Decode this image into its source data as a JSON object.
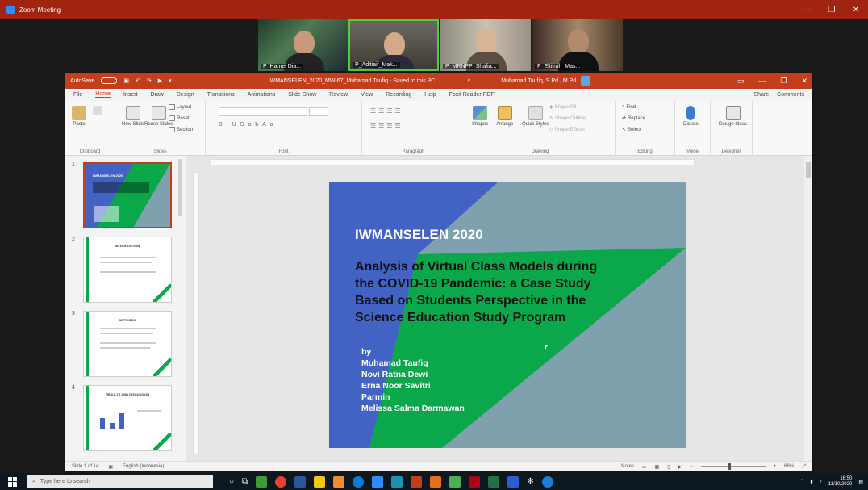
{
  "zoom": {
    "window_title": "Zoom Meeting",
    "participants": [
      {
        "name": "P_Hamel Dia..."
      },
      {
        "name": "P_Aditiaif_Mak..."
      },
      {
        "name": "P_MRNPP_Shafia..."
      },
      {
        "name": "P_Eltifrah_Mas..."
      }
    ]
  },
  "ppt": {
    "autosave_label": "AutoSave",
    "autosave_state": "Off",
    "doc_title": "IWMANSELEN_2020_MW-67_Muhamad Taufiq - Saved to this PC",
    "user_name": "Muhamad Taufiq, S.Pd., M.Pd",
    "tabs": [
      "File",
      "Home",
      "Insert",
      "Draw",
      "Design",
      "Transitions",
      "Animations",
      "Slide Show",
      "Review",
      "View",
      "Recording",
      "Help",
      "Foxit Reader PDF"
    ],
    "active_tab": "Home",
    "share_label": "Share",
    "comments_label": "Comments",
    "ribbon_groups": {
      "clipboard": "Clipboard",
      "slides": "Slides",
      "font": "Font",
      "paragraph": "Paragraph",
      "drawing": "Drawing",
      "editing": "Editing",
      "voice": "Voice",
      "designer": "Designer"
    },
    "ribbon_buttons": {
      "paste": "Paste",
      "new_slide": "New Slide",
      "reuse_slides": "Reuse Slides",
      "layout": "Layout",
      "reset": "Reset",
      "section": "Section",
      "shapes": "Shapes",
      "arrange": "Arrange",
      "quick_styles": "Quick Styles",
      "shape_fill": "Shape Fill",
      "shape_outline": "Shape Outline",
      "shape_effects": "Shape Effects",
      "find": "Find",
      "replace": "Replace",
      "select": "Select",
      "dictate": "Dictate",
      "design_ideas": "Design Ideas"
    },
    "thumbnails": [
      {
        "num": "1",
        "title": "IWMANSELEN 2020"
      },
      {
        "num": "2",
        "title": "INTRODUCTION"
      },
      {
        "num": "3",
        "title": "METHODS"
      },
      {
        "num": "4",
        "title": "RESULTS AND DISCUSSION"
      }
    ],
    "slide": {
      "headline": "IWMANSELEN 2020",
      "title_lines": [
        "Analysis of Virtual Class Models during",
        "the COVID-19 Pandemic: a Case Study",
        "Based on Students Perspective in the",
        "Science Education Study Program"
      ],
      "by": "by",
      "authors": [
        "Muhamad Taufiq",
        "Novi Ratna Dewi",
        "Erna Noor Savitri",
        "Parmin",
        "Melissa Salma Darmawan"
      ]
    },
    "status": {
      "slide_count": "Slide 1 of 14",
      "language": "English (Indonesia)",
      "notes": "Notes",
      "zoom_pct": "68%"
    }
  },
  "taskbar": {
    "search_placeholder": "Type here to search",
    "time": "16:50",
    "date": "11/10/2020"
  },
  "colors": {
    "zoom_bar": "#a0240f",
    "ppt_accent": "#c43e1c",
    "slide_blue": "#4263c4",
    "slide_green": "#0aa84a",
    "slide_gray": "#7fa1ae"
  }
}
